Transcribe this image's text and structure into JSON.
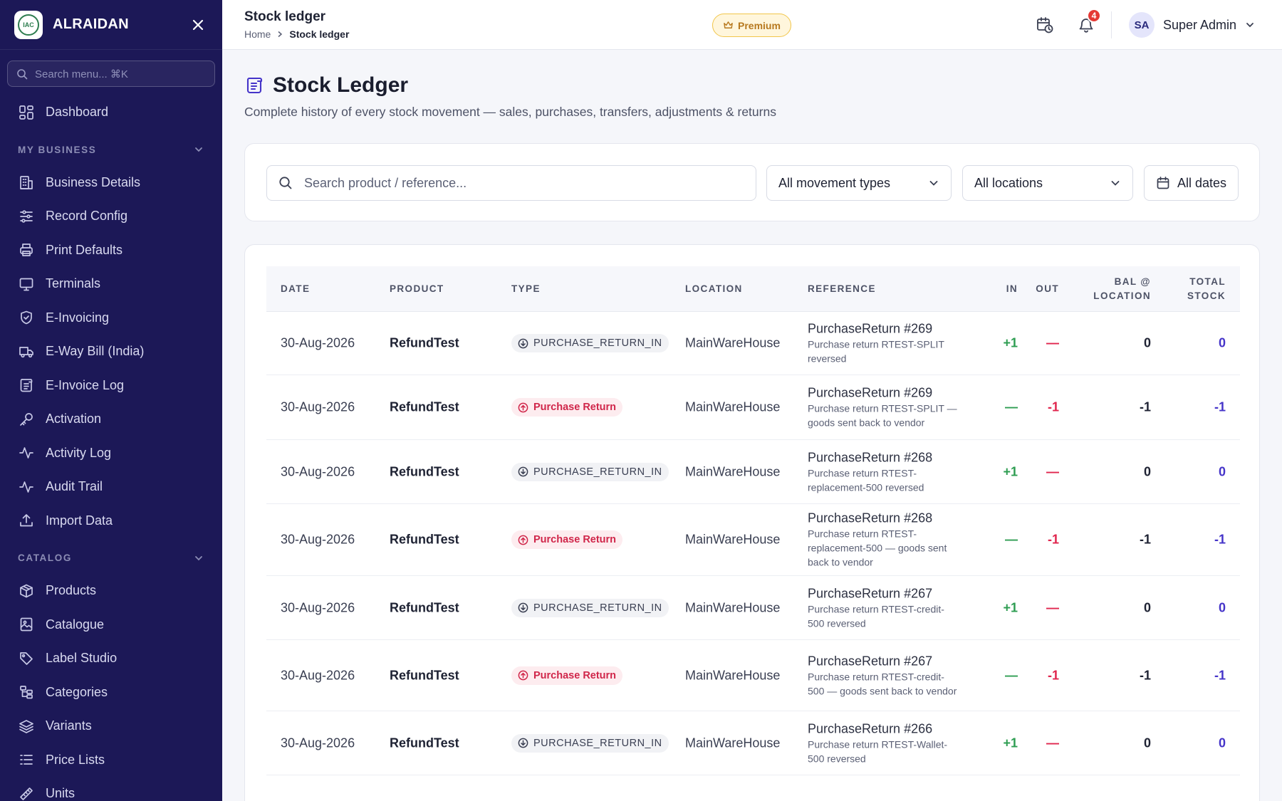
{
  "brand": {
    "name": "ALRAIDAN",
    "logo_text": "IAC"
  },
  "sidebar": {
    "search_placeholder": "Search menu... ⌘K",
    "dashboard": "Dashboard",
    "sections": [
      {
        "label": "MY BUSINESS"
      },
      {
        "label": "CATALOG"
      }
    ],
    "business_items": [
      {
        "label": "Business Details",
        "icon": "building-icon"
      },
      {
        "label": "Record Config",
        "icon": "sliders-icon"
      },
      {
        "label": "Print Defaults",
        "icon": "printer-icon"
      },
      {
        "label": "Terminals",
        "icon": "monitor-icon"
      },
      {
        "label": "E-Invoicing",
        "icon": "shield-check-icon"
      },
      {
        "label": "E-Way Bill (India)",
        "icon": "truck-icon"
      },
      {
        "label": "E-Invoice Log",
        "icon": "scroll-icon"
      },
      {
        "label": "Activation",
        "icon": "key-icon"
      },
      {
        "label": "Activity Log",
        "icon": "activity-icon"
      },
      {
        "label": "Audit Trail",
        "icon": "activity-icon"
      },
      {
        "label": "Import Data",
        "icon": "upload-icon"
      }
    ],
    "catalog_items": [
      {
        "label": "Products",
        "icon": "box-icon"
      },
      {
        "label": "Catalogue",
        "icon": "book-image-icon"
      },
      {
        "label": "Label Studio",
        "icon": "tag-icon"
      },
      {
        "label": "Categories",
        "icon": "folder-tree-icon"
      },
      {
        "label": "Variants",
        "icon": "layers-icon"
      },
      {
        "label": "Price Lists",
        "icon": "list-icon"
      },
      {
        "label": "Units",
        "icon": "ruler-icon"
      }
    ]
  },
  "topbar": {
    "title": "Stock ledger",
    "breadcrumb": [
      "Home",
      "Stock ledger"
    ],
    "premium_label": "Premium",
    "notification_count": "4",
    "user_initials": "SA",
    "user_name": "Super Admin"
  },
  "page": {
    "title": "Stock Ledger",
    "subtitle": "Complete history of every stock movement — sales, purchases, transfers, adjustments & returns"
  },
  "filters": {
    "search_placeholder": "Search product / reference...",
    "movement_type": "All movement types",
    "location": "All locations",
    "dates": "All dates"
  },
  "table": {
    "headers": {
      "date": "DATE",
      "product": "PRODUCT",
      "type": "TYPE",
      "location": "LOCATION",
      "reference": "REFERENCE",
      "in": "IN",
      "out": "OUT",
      "bal_line1": "BAL @",
      "bal_line2": "LOCATION",
      "total_line1": "TOTAL",
      "total_line2": "STOCK"
    },
    "rows": [
      {
        "date": "30-Aug-2026",
        "product": "RefundTest",
        "type": "PURCHASE_RETURN_IN",
        "kind": "in",
        "location": "MainWareHouse",
        "ref_title": "PurchaseReturn #269",
        "ref_note": "Purchase return RTEST-SPLIT reversed",
        "in": "+1",
        "out": "—",
        "bal": "0",
        "total": "0"
      },
      {
        "date": "30-Aug-2026",
        "product": "RefundTest",
        "type": "Purchase Return",
        "kind": "ret",
        "location": "MainWareHouse",
        "ref_title": "PurchaseReturn #269",
        "ref_note": "Purchase return RTEST-SPLIT — goods sent back to vendor",
        "in": "—",
        "out": "-1",
        "bal": "-1",
        "total": "-1"
      },
      {
        "date": "30-Aug-2026",
        "product": "RefundTest",
        "type": "PURCHASE_RETURN_IN",
        "kind": "in",
        "location": "MainWareHouse",
        "ref_title": "PurchaseReturn #268",
        "ref_note": "Purchase return RTEST-replacement-500 reversed",
        "in": "+1",
        "out": "—",
        "bal": "0",
        "total": "0"
      },
      {
        "date": "30-Aug-2026",
        "product": "RefundTest",
        "type": "Purchase Return",
        "kind": "ret",
        "location": "MainWareHouse",
        "ref_title": "PurchaseReturn #268",
        "ref_note": "Purchase return RTEST-replacement-500 — goods sent back to vendor",
        "in": "—",
        "out": "-1",
        "bal": "-1",
        "total": "-1"
      },
      {
        "date": "30-Aug-2026",
        "product": "RefundTest",
        "type": "PURCHASE_RETURN_IN",
        "kind": "in",
        "location": "MainWareHouse",
        "ref_title": "PurchaseReturn #267",
        "ref_note": "Purchase return RTEST-credit-500 reversed",
        "in": "+1",
        "out": "—",
        "bal": "0",
        "total": "0"
      },
      {
        "date": "30-Aug-2026",
        "product": "RefundTest",
        "type": "Purchase Return",
        "kind": "ret",
        "location": "MainWareHouse",
        "ref_title": "PurchaseReturn #267",
        "ref_note": "Purchase return RTEST-credit-500 — goods sent back to vendor",
        "in": "—",
        "out": "-1",
        "bal": "-1",
        "total": "-1"
      },
      {
        "date": "30-Aug-2026",
        "product": "RefundTest",
        "type": "PURCHASE_RETURN_IN",
        "kind": "in",
        "location": "MainWareHouse",
        "ref_title": "PurchaseReturn #266",
        "ref_note": "Purchase return RTEST-Wallet-500 reversed",
        "in": "+1",
        "out": "—",
        "bal": "0",
        "total": "0"
      }
    ]
  },
  "colors": {
    "sidebar": "#1c1857",
    "accent": "#4534c9",
    "in": "#2e9d52",
    "out": "#e0254d",
    "premium": "#b7791f"
  }
}
